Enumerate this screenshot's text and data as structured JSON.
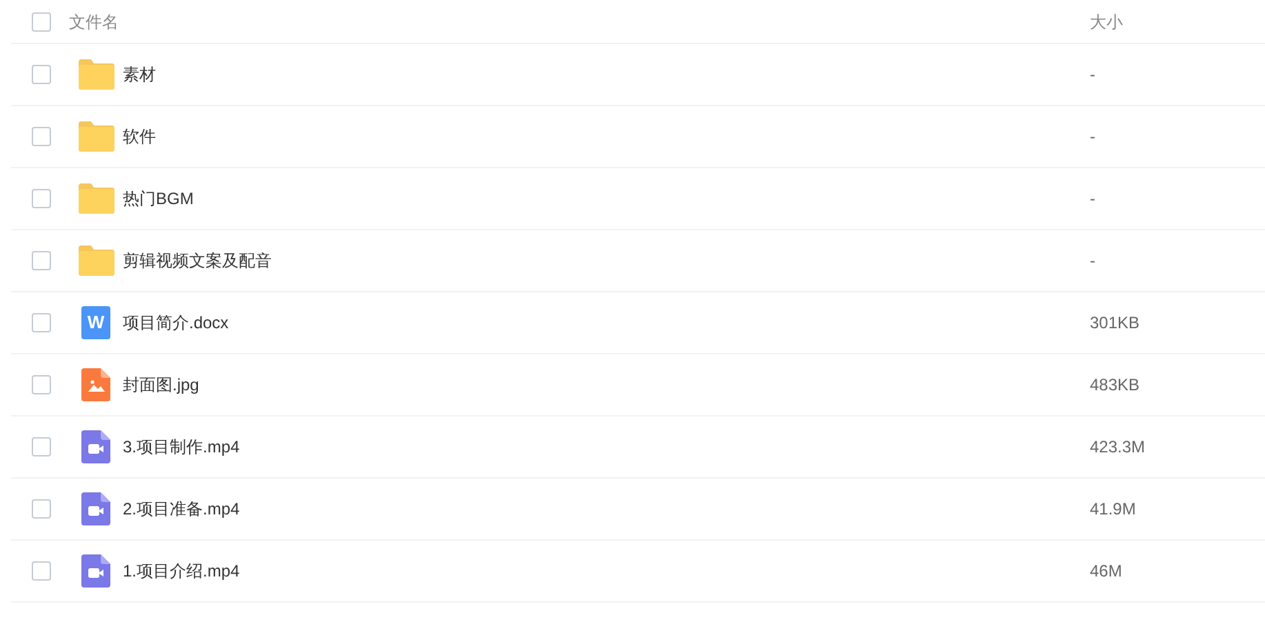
{
  "table": {
    "columns": [
      "文件名",
      "大小"
    ],
    "header_checked": false,
    "rows": [
      {
        "kind": "folder",
        "name": "素材",
        "size": "-",
        "checked": false
      },
      {
        "kind": "folder",
        "name": "软件",
        "size": "-",
        "checked": false
      },
      {
        "kind": "folder",
        "name": "热门BGM",
        "size": "-",
        "checked": false
      },
      {
        "kind": "folder",
        "name": "剪辑视频文案及配音",
        "size": "-",
        "checked": false
      },
      {
        "kind": "doc",
        "icon_letter": "W",
        "name": "项目简介.docx",
        "size": "301KB",
        "checked": false
      },
      {
        "kind": "image",
        "name": "封面图.jpg",
        "size": "483KB",
        "checked": false
      },
      {
        "kind": "video",
        "name": "3.项目制作.mp4",
        "size": "423.3M",
        "checked": false
      },
      {
        "kind": "video",
        "name": "2.项目准备.mp4",
        "size": "41.9M",
        "checked": false
      },
      {
        "kind": "video",
        "name": "1.项目介绍.mp4",
        "size": "46M",
        "checked": false
      }
    ]
  }
}
